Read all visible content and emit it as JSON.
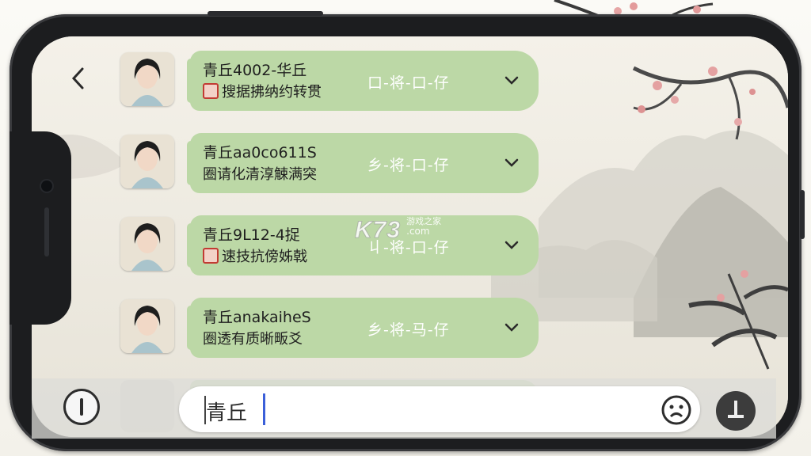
{
  "servers": [
    {
      "name": "青丘4002-华丘",
      "desc": "搜据拂纳约转贯",
      "time": "口-将-口-仔",
      "seal": true
    },
    {
      "name": "青丘aa0co611S",
      "desc": "圈请化清淳觫满突",
      "time": "乡-将-口-仔",
      "seal": false
    },
    {
      "name": "青丘9L12-4捉",
      "desc": "速技抗傍姊戟",
      "time": "丩-将-口-仔",
      "seal": true
    },
    {
      "name": "青丘anakaiheS",
      "desc": "圈透有质晰畈爻",
      "time": "乡-将-马-仔",
      "seal": false
    }
  ],
  "input": {
    "value": "青丘"
  },
  "watermark": {
    "brand": "K73",
    "cn": "游戏之家",
    "domain": ".com"
  },
  "colors": {
    "bubble": "#bcd8a6",
    "caret": "#3b5fd9",
    "seal": "#c23b33"
  },
  "icons": {
    "back": "chevron-left-icon",
    "expand": "chevron-down-icon",
    "info": "info-icon",
    "emoji": "emoji-icon",
    "send": "send-icon"
  }
}
